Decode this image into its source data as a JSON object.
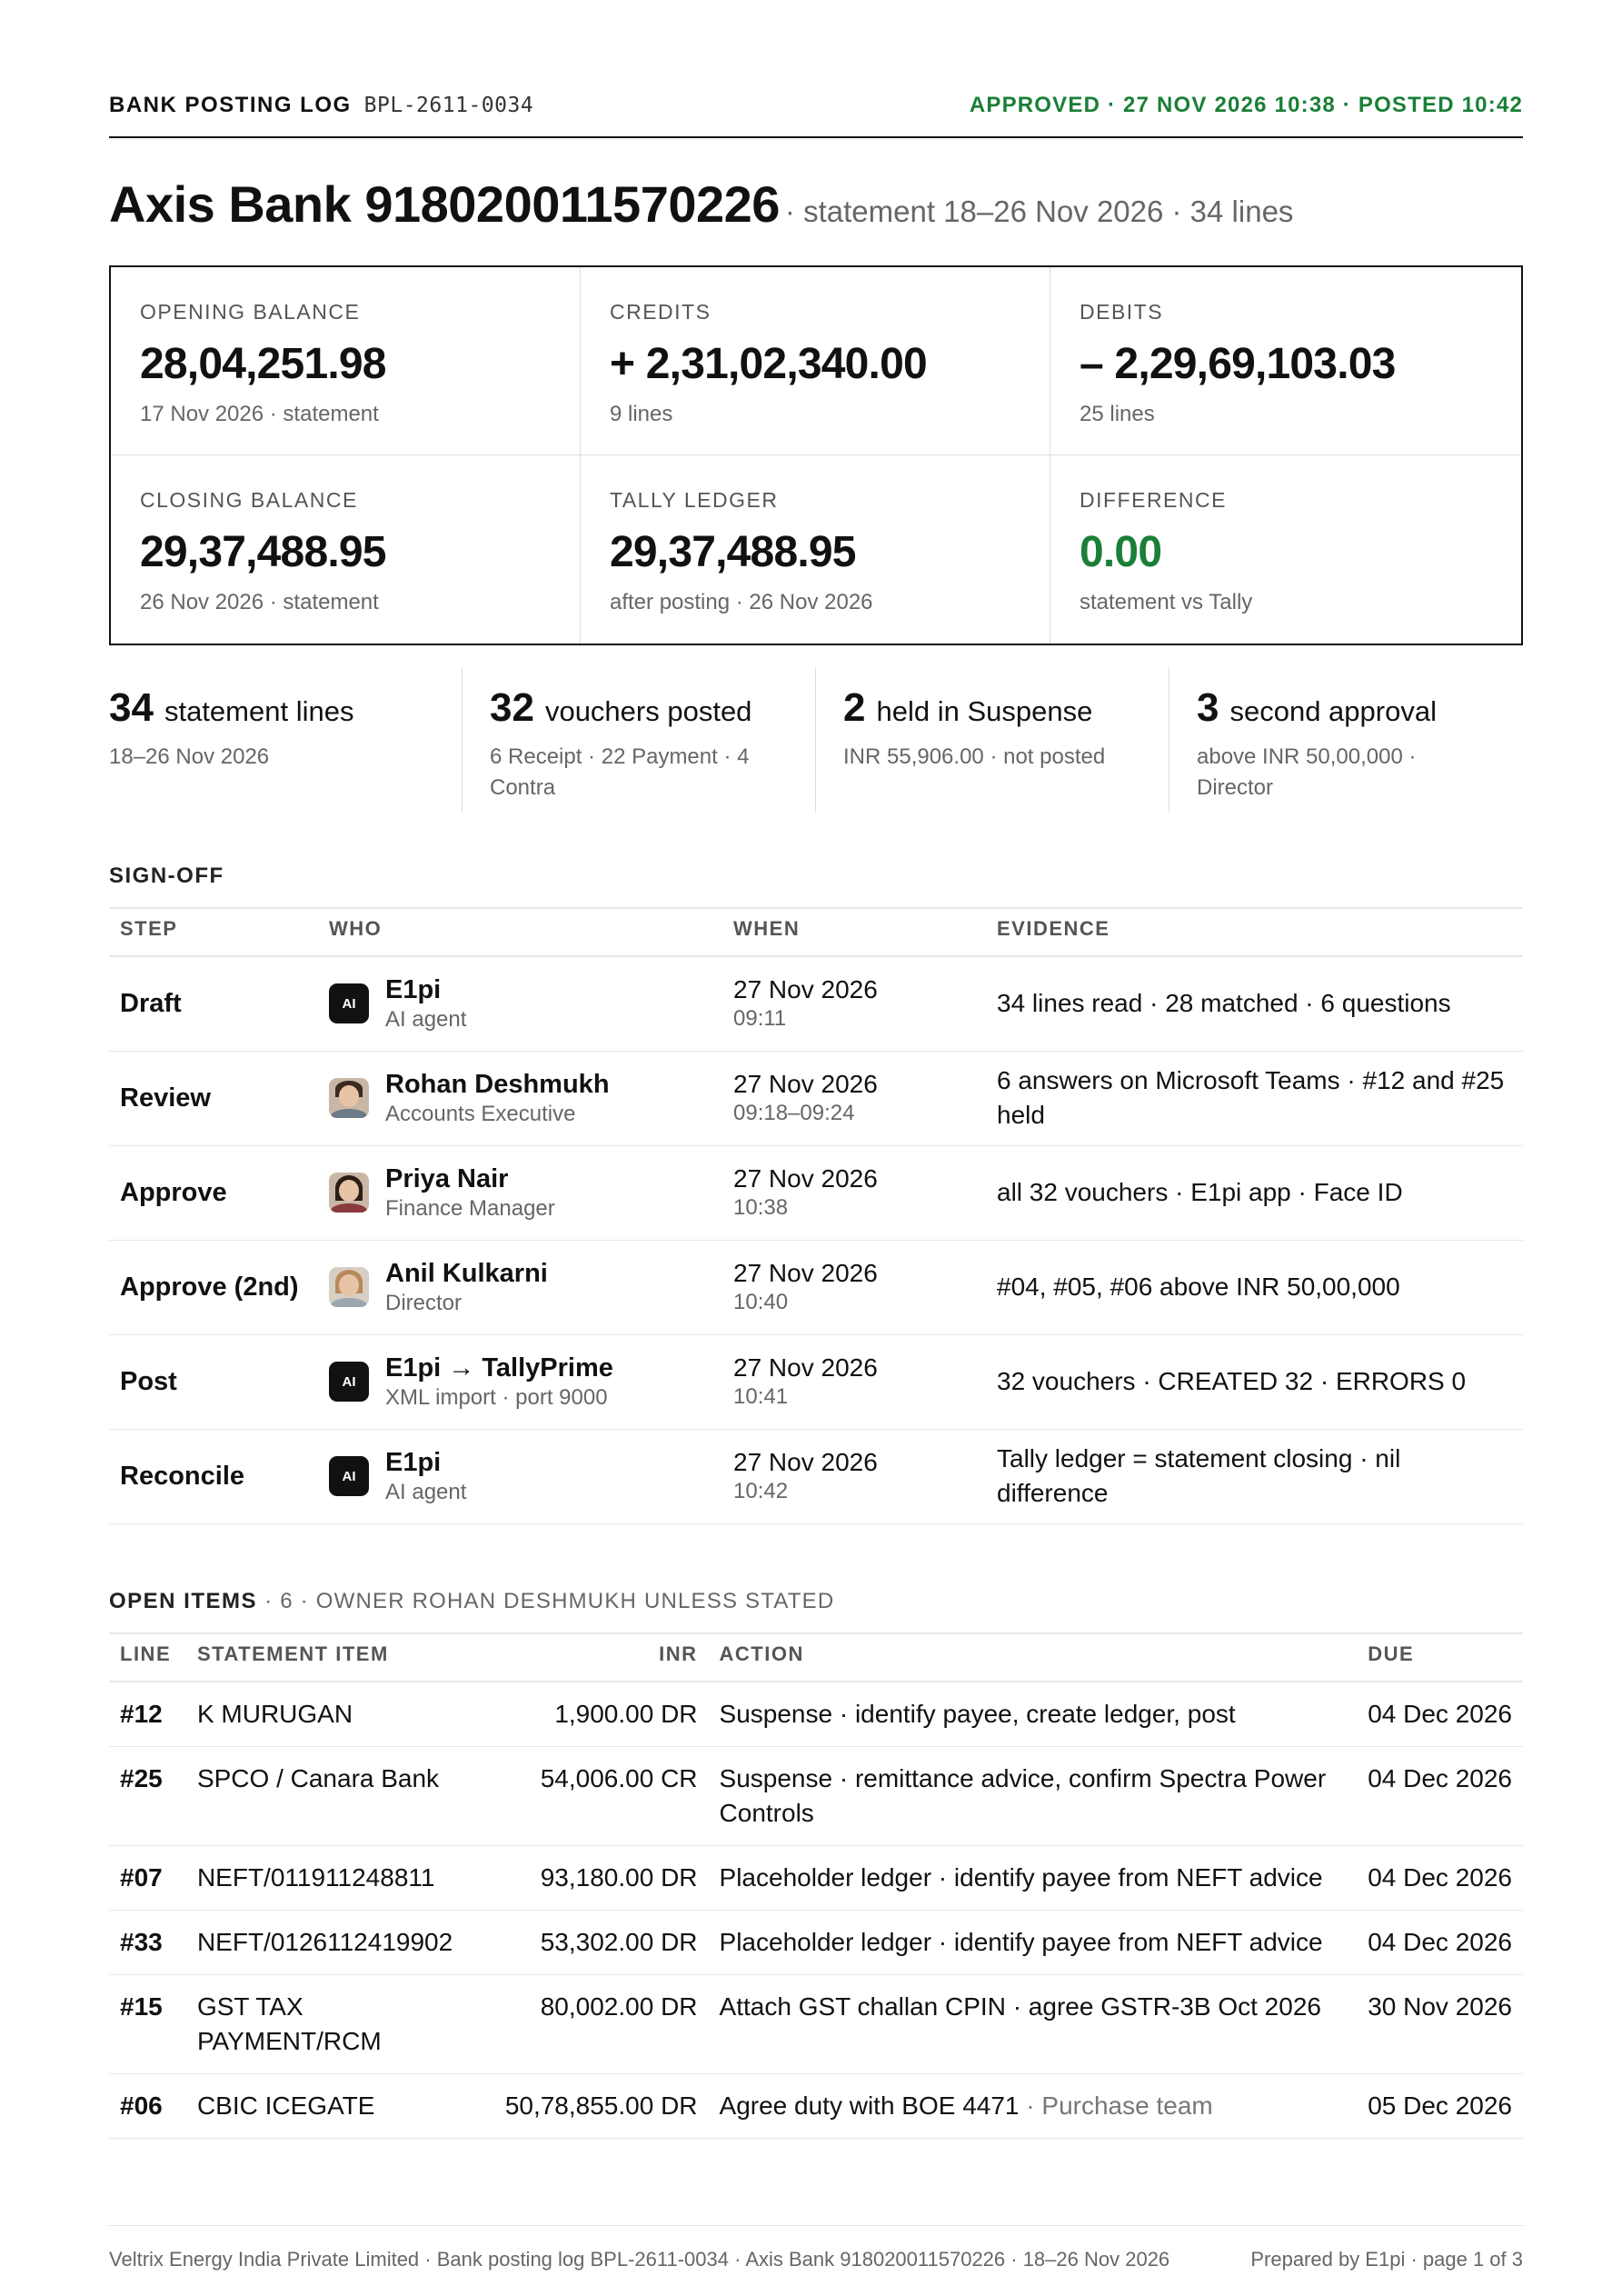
{
  "header": {
    "doc_type": "BANK POSTING LOG",
    "doc_code": "BPL-2611-0034",
    "status": "APPROVED · 27 NOV 2026 10:38 · POSTED 10:42"
  },
  "title": {
    "bank": "Axis Bank 918020011570226",
    "meta": "· statement 18–26 Nov 2026 · 34 lines"
  },
  "balances": [
    {
      "label": "OPENING BALANCE",
      "value": "28,04,251.98",
      "sub": "17 Nov 2026 · statement"
    },
    {
      "label": "CREDITS",
      "value": "+ 2,31,02,340.00",
      "sub": "9 lines"
    },
    {
      "label": "DEBITS",
      "value": "– 2,29,69,103.03",
      "sub": "25 lines"
    },
    {
      "label": "CLOSING BALANCE",
      "value": "29,37,488.95",
      "sub": "26 Nov 2026 · statement"
    },
    {
      "label": "TALLY LEDGER",
      "value": "29,37,488.95",
      "sub": "after posting · 26 Nov 2026"
    },
    {
      "label": "DIFFERENCE",
      "value": "0.00",
      "sub": "statement vs Tally"
    }
  ],
  "stats": [
    {
      "big": "34",
      "label": "statement lines",
      "desc": "18–26 Nov 2026"
    },
    {
      "big": "32",
      "label": "vouchers posted",
      "desc": "6 Receipt · 22 Payment · 4 Contra"
    },
    {
      "big": "2",
      "label": "held in Suspense",
      "desc": "INR 55,906.00 · not posted"
    },
    {
      "big": "3",
      "label": "second approval",
      "desc": "above INR 50,00,000 · Director"
    }
  ],
  "signoff": {
    "title": "SIGN-OFF",
    "columns": [
      "STEP",
      "WHO",
      "WHEN",
      "EVIDENCE"
    ],
    "rows": [
      {
        "step": "Draft",
        "avatar": "AI",
        "name": "E1pi",
        "role": "AI agent",
        "date": "27 Nov 2026",
        "time": "09:11",
        "evidence": "34 lines read · 28 matched · 6 questions"
      },
      {
        "step": "Review",
        "avatar": "",
        "name": "Rohan Deshmukh",
        "role": "Accounts Executive",
        "date": "27 Nov 2026",
        "time": "09:18–09:24",
        "evidence": "6 answers on Microsoft Teams · #12 and #25 held"
      },
      {
        "step": "Approve",
        "avatar": "",
        "name": "Priya Nair",
        "role": "Finance Manager",
        "date": "27 Nov 2026",
        "time": "10:38",
        "evidence": "all 32 vouchers · E1pi app · Face ID"
      },
      {
        "step": "Approve (2nd)",
        "avatar": "",
        "name": "Anil Kulkarni",
        "role": "Director",
        "date": "27 Nov 2026",
        "time": "10:40",
        "evidence": "#04, #05, #06 above INR 50,00,000"
      },
      {
        "step": "Post",
        "avatar": "AI",
        "name": "E1pi → TallyPrime",
        "role": "XML import · port 9000",
        "date": "27 Nov 2026",
        "time": "10:41",
        "evidence": "32 vouchers · CREATED 32 · ERRORS 0"
      },
      {
        "step": "Reconcile",
        "avatar": "AI",
        "name": "E1pi",
        "role": "AI agent",
        "date": "27 Nov 2026",
        "time": "10:42",
        "evidence": "Tally ledger = statement closing · nil difference"
      }
    ]
  },
  "open_items": {
    "title": "OPEN ITEMS",
    "subtitle": "· 6 · OWNER ROHAN DESHMUKH UNLESS STATED",
    "columns": [
      "LINE",
      "STATEMENT ITEM",
      "INR",
      "ACTION",
      "DUE"
    ],
    "rows": [
      {
        "line": "#12",
        "item": "K MURUGAN",
        "inr": "1,900.00 DR",
        "action": "Suspense · identify payee, create ledger, post",
        "action_note": "",
        "due": "04 Dec 2026"
      },
      {
        "line": "#25",
        "item": "SPCO / Canara Bank",
        "inr": "54,006.00 CR",
        "action": "Suspense · remittance advice, confirm Spectra Power Controls",
        "action_note": "",
        "due": "04 Dec 2026"
      },
      {
        "line": "#07",
        "item": "NEFT/011911248811",
        "inr": "93,180.00 DR",
        "action": "Placeholder ledger · identify payee from NEFT advice",
        "action_note": "",
        "due": "04 Dec 2026"
      },
      {
        "line": "#33",
        "item": "NEFT/0126112419902",
        "inr": "53,302.00 DR",
        "action": "Placeholder ledger · identify payee from NEFT advice",
        "action_note": "",
        "due": "04 Dec 2026"
      },
      {
        "line": "#15",
        "item": "GST TAX PAYMENT/RCM",
        "inr": "80,002.00 DR",
        "action": "Attach GST challan CPIN · agree GSTR-3B Oct 2026",
        "action_note": "",
        "due": "30 Nov 2026"
      },
      {
        "line": "#06",
        "item": "CBIC ICEGATE",
        "inr": "50,78,855.00 DR",
        "action": "Agree duty with BOE 4471",
        "action_note": " · Purchase team",
        "due": "05 Dec 2026"
      }
    ]
  },
  "footer": {
    "left": "Veltrix Energy India Private Limited · Bank posting log BPL-2611-0034 · Axis Bank 918020011570226 · 18–26 Nov 2026",
    "right": "Prepared by E1pi · page 1 of 3"
  },
  "colors": {
    "approved_green": "#1a7f37",
    "text": "#111111",
    "muted": "#666666"
  }
}
